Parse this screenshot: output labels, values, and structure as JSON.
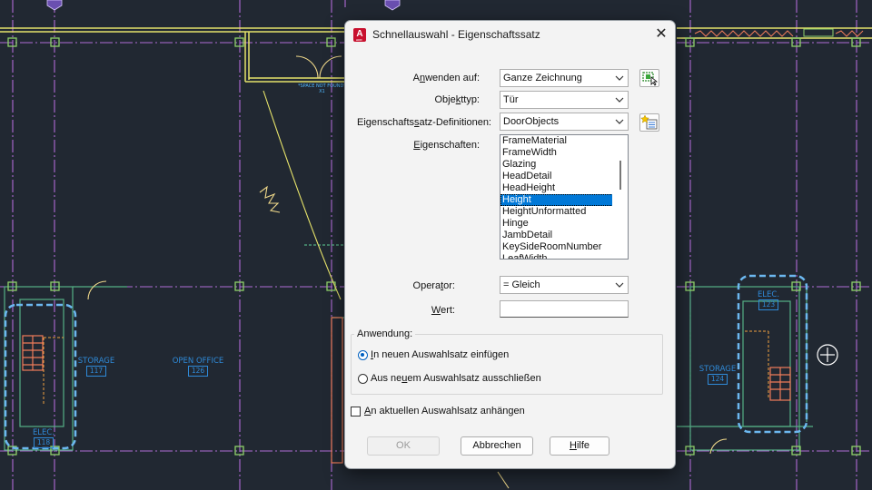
{
  "drawing": {
    "labels": [
      {
        "name": "storage",
        "text": "STORAGE",
        "num": "117"
      },
      {
        "name": "open-office",
        "text": "OPEN  OFFICE",
        "num": "126"
      },
      {
        "name": "elec",
        "text": "ELEC.",
        "num": "118"
      },
      {
        "name": "storage-right",
        "text": "STORAGE",
        "num": "124"
      },
      {
        "name": "elec-right",
        "text": "ELEC.",
        "num": "123"
      }
    ],
    "space_tag": "*SPACE NOT FOUND*",
    "space_num": "X1",
    "colors": {
      "background": "#212832",
      "grid": "#b06bd6",
      "wall": "#e6e36a",
      "door": "#f0d98a",
      "stair": "#f07c5a",
      "highlight": "#6cb8f0",
      "column": "#8fd16a"
    }
  },
  "dialog": {
    "title": "Schnellauswahl - Eigenschaftssatz",
    "app_icon": "A",
    "app_icon_sub": "ACD",
    "fields": {
      "apply_to": {
        "label_pre": "A",
        "label_u": "n",
        "label_post": "wenden auf:",
        "value": "Ganze Zeichnung"
      },
      "object_type": {
        "label_pre": "Obje",
        "label_u": "k",
        "label_post": "ttyp:",
        "value": "Tür"
      },
      "property_set": {
        "label_pre": "Eigenschafts",
        "label_u": "s",
        "label_post": "atz-Definitionen:",
        "value": "DoorObjects"
      },
      "properties": {
        "label_pre": "",
        "label_u": "E",
        "label_post": "igenschaften:"
      },
      "operator": {
        "label_pre": "Opera",
        "label_u": "t",
        "label_post": "or:",
        "value": "= Gleich"
      },
      "value": {
        "label_pre": "",
        "label_u": "W",
        "label_post": "ert:",
        "value": ""
      }
    },
    "property_list": [
      {
        "text": "FrameMaterial",
        "selected": false
      },
      {
        "text": "FrameWidth",
        "selected": false
      },
      {
        "text": "Glazing",
        "selected": false
      },
      {
        "text": "HeadDetail",
        "selected": false
      },
      {
        "text": "HeadHeight",
        "selected": false
      },
      {
        "text": "Height",
        "selected": true
      },
      {
        "text": "HeightUnformatted",
        "selected": false
      },
      {
        "text": "Hinge",
        "selected": false
      },
      {
        "text": "JambDetail",
        "selected": false
      },
      {
        "text": "KeySideRoomNumber",
        "selected": false
      },
      {
        "text": "LeafWidth",
        "selected": false
      }
    ],
    "application": {
      "title": "Anwendung:",
      "include": {
        "pre": "",
        "u": "I",
        "post": "n neuen Auswahlsatz einfügen",
        "checked": true
      },
      "exclude": {
        "pre": "Aus ne",
        "u": "u",
        "post": "em Auswahlsatz ausschließen",
        "checked": false
      }
    },
    "append": {
      "pre": "",
      "u": "A",
      "post": "n aktuellen Auswahlsatz anhängen",
      "checked": false
    },
    "buttons": {
      "ok": "OK",
      "cancel": "Abbrechen",
      "help_u": "H",
      "help_post": "ilfe"
    },
    "close_glyph": "✕"
  }
}
